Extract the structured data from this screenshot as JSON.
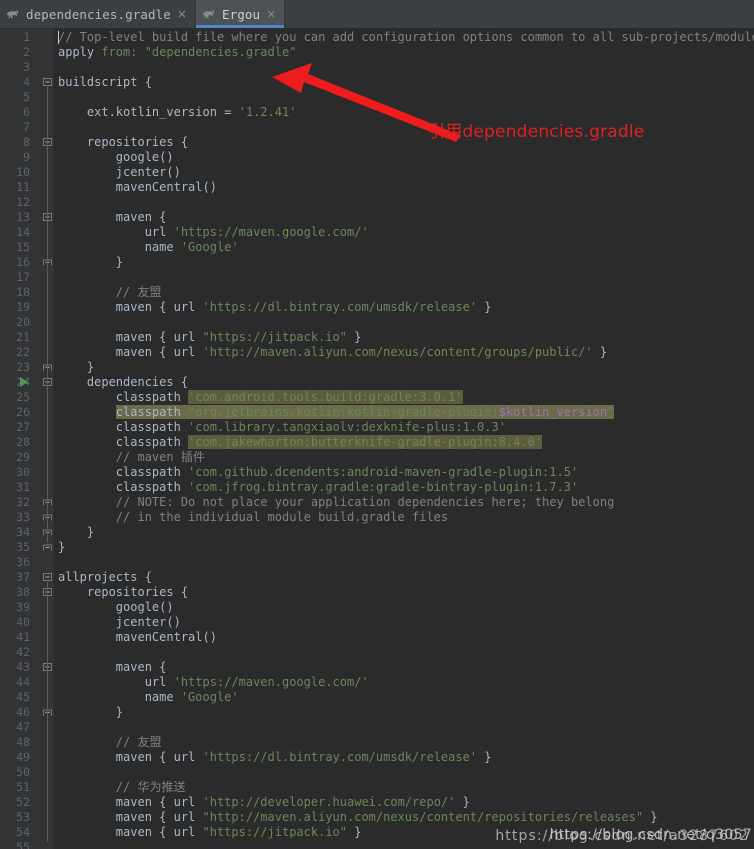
{
  "window": {
    "background_color": "#2b2b2b",
    "gutter_color": "#313335",
    "accent_color": "#4a88c7"
  },
  "tabs": [
    {
      "label": "dependencies.gradle",
      "icon": "gradle-elephant-icon",
      "close": "×",
      "active": false
    },
    {
      "label": "Ergou",
      "icon": "gradle-elephant-icon",
      "close": "×",
      "active": true
    }
  ],
  "annotation": {
    "text": "引用dependencies.gradle",
    "color": "#e02020",
    "arrow": "red-arrow-icon"
  },
  "watermark": {
    "front": "https://blog.csdn.net/q3057",
    "back": "https://blog.csdn.net/a3287602"
  },
  "editor": {
    "lines": [
      {
        "n": 1,
        "text": "// Top-level build file where you can add configuration options common to all sub-projects/modules.",
        "style": "comment",
        "caret": true
      },
      {
        "n": 2,
        "text": "apply from: \"dependencies.gradle\"",
        "style": "apply"
      },
      {
        "n": 3,
        "text": ""
      },
      {
        "n": 4,
        "text": "buildscript {",
        "style": "plain",
        "fold": "open"
      },
      {
        "n": 5,
        "text": ""
      },
      {
        "n": 6,
        "text": "    ext.kotlin_version = '1.2.41'",
        "style": "assign"
      },
      {
        "n": 7,
        "text": ""
      },
      {
        "n": 8,
        "text": "    repositories {",
        "style": "plain",
        "fold": "open"
      },
      {
        "n": 9,
        "text": "        google()",
        "style": "plain"
      },
      {
        "n": 10,
        "text": "        jcenter()",
        "style": "plain"
      },
      {
        "n": 11,
        "text": "        mavenCentral()",
        "style": "plain"
      },
      {
        "n": 12,
        "text": ""
      },
      {
        "n": 13,
        "text": "        maven {",
        "style": "plain",
        "fold": "open"
      },
      {
        "n": 14,
        "text": "            url 'https://maven.google.com/'",
        "style": "urlstr"
      },
      {
        "n": 15,
        "text": "            name 'Google'",
        "style": "urlstr"
      },
      {
        "n": 16,
        "text": "        }",
        "style": "plain",
        "fold": "close"
      },
      {
        "n": 17,
        "text": ""
      },
      {
        "n": 18,
        "text": "        // 友盟",
        "style": "comment"
      },
      {
        "n": 19,
        "text": "        maven { url 'https://dl.bintray.com/umsdk/release' }",
        "style": "mavenline"
      },
      {
        "n": 20,
        "text": ""
      },
      {
        "n": 21,
        "text": "        maven { url \"https://jitpack.io\" }",
        "style": "mavenline"
      },
      {
        "n": 22,
        "text": "        maven { url 'http://maven.aliyun.com/nexus/content/groups/public/' }",
        "style": "mavenline"
      },
      {
        "n": 23,
        "text": "    }",
        "style": "plain",
        "fold": "close"
      },
      {
        "n": 24,
        "text": "    dependencies {",
        "style": "plain",
        "fold": "open",
        "run": true
      },
      {
        "n": 25,
        "text": "        classpath 'com.android.tools.build:gradle:3.0.1'",
        "style": "classpath",
        "highlight": "string"
      },
      {
        "n": 26,
        "text": "        classpath \"org.jetbrains.kotlin:kotlin-gradle-plugin:$kotlin_version\"",
        "style": "classpath-var",
        "highlight": "full"
      },
      {
        "n": 27,
        "text": "        classpath 'com.library.tangxiaolv:dexknife-plus:1.0.3'",
        "style": "classpath"
      },
      {
        "n": 28,
        "text": "        classpath 'com.jakewharton:butterknife-gradle-plugin:8.4.0'",
        "style": "classpath",
        "highlight": "string"
      },
      {
        "n": 29,
        "text": "        // maven 插件",
        "style": "comment"
      },
      {
        "n": 30,
        "text": "        classpath 'com.github.dcendents:android-maven-gradle-plugin:1.5'",
        "style": "classpath"
      },
      {
        "n": 31,
        "text": "        classpath 'com.jfrog.bintray.gradle:gradle-bintray-plugin:1.7.3'",
        "style": "classpath"
      },
      {
        "n": 32,
        "text": "        // NOTE: Do not place your application dependencies here; they belong",
        "style": "comment",
        "fold": "close"
      },
      {
        "n": 33,
        "text": "        // in the individual module build.gradle files",
        "style": "comment",
        "fold": "close"
      },
      {
        "n": 34,
        "text": "    }",
        "style": "plain",
        "fold": "close"
      },
      {
        "n": 35,
        "text": "}",
        "style": "plain",
        "fold": "close"
      },
      {
        "n": 36,
        "text": ""
      },
      {
        "n": 37,
        "text": "allprojects {",
        "style": "plain",
        "fold": "open"
      },
      {
        "n": 38,
        "text": "    repositories {",
        "style": "plain",
        "fold": "open"
      },
      {
        "n": 39,
        "text": "        google()",
        "style": "plain"
      },
      {
        "n": 40,
        "text": "        jcenter()",
        "style": "plain"
      },
      {
        "n": 41,
        "text": "        mavenCentral()",
        "style": "plain"
      },
      {
        "n": 42,
        "text": ""
      },
      {
        "n": 43,
        "text": "        maven {",
        "style": "plain",
        "fold": "open"
      },
      {
        "n": 44,
        "text": "            url 'https://maven.google.com/'",
        "style": "urlstr"
      },
      {
        "n": 45,
        "text": "            name 'Google'",
        "style": "urlstr"
      },
      {
        "n": 46,
        "text": "        }",
        "style": "plain",
        "fold": "close"
      },
      {
        "n": 47,
        "text": ""
      },
      {
        "n": 48,
        "text": "        // 友盟",
        "style": "comment"
      },
      {
        "n": 49,
        "text": "        maven { url 'https://dl.bintray.com/umsdk/release' }",
        "style": "mavenline"
      },
      {
        "n": 50,
        "text": ""
      },
      {
        "n": 51,
        "text": "        // 华为推送",
        "style": "comment"
      },
      {
        "n": 52,
        "text": "        maven { url 'http://developer.huawei.com/repo/' }",
        "style": "mavenline"
      },
      {
        "n": 53,
        "text": "        maven { url \"http://maven.aliyun.com/nexus/content/repositories/releases\" }",
        "style": "mavenline"
      },
      {
        "n": 54,
        "text": "        maven { url \"https://jitpack.io\" }",
        "style": "mavenline"
      },
      {
        "n": 55,
        "text": ""
      }
    ]
  }
}
